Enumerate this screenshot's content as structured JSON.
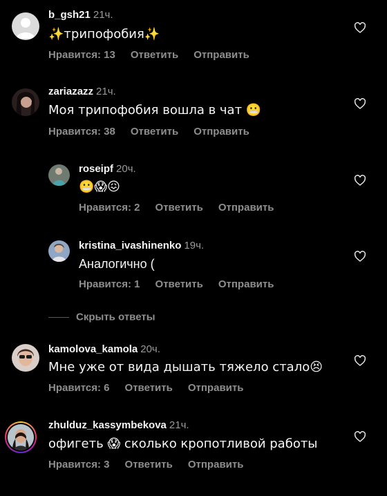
{
  "actions": {
    "like_prefix": "Нравится:",
    "reply": "Ответить",
    "send": "Отправить"
  },
  "hide_replies": "Скрыть ответы",
  "comments": [
    {
      "username": "b_gsh21",
      "time": "21ч.",
      "text": "✨трипофобия✨",
      "likes": "Нравится: 13"
    },
    {
      "username": "zariazazz",
      "time": "21ч.",
      "text": "Моя трипофобия вошла в чат 😬",
      "likes": "Нравится: 38"
    },
    {
      "username": "roseipf",
      "time": "20ч.",
      "text": "😬😱😖",
      "likes": "Нравится: 2"
    },
    {
      "username": "kristina_ivashinenko",
      "time": "19ч.",
      "text": "Аналогично (",
      "likes": "Нравится: 1"
    },
    {
      "username": "kamolova_kamola",
      "time": "20ч.",
      "text": "Мне уже от вида дышать тяжело стало😣",
      "likes": "Нравится: 6"
    },
    {
      "username": "zhulduz_kassymbekova",
      "time": "21ч.",
      "text": "офигеть 😱 сколько кропотливой работы",
      "likes": "Нравится: 3"
    }
  ],
  "colors": {
    "background": "#000000",
    "text": "#f5f5f5",
    "muted": "#8e8e8e"
  }
}
